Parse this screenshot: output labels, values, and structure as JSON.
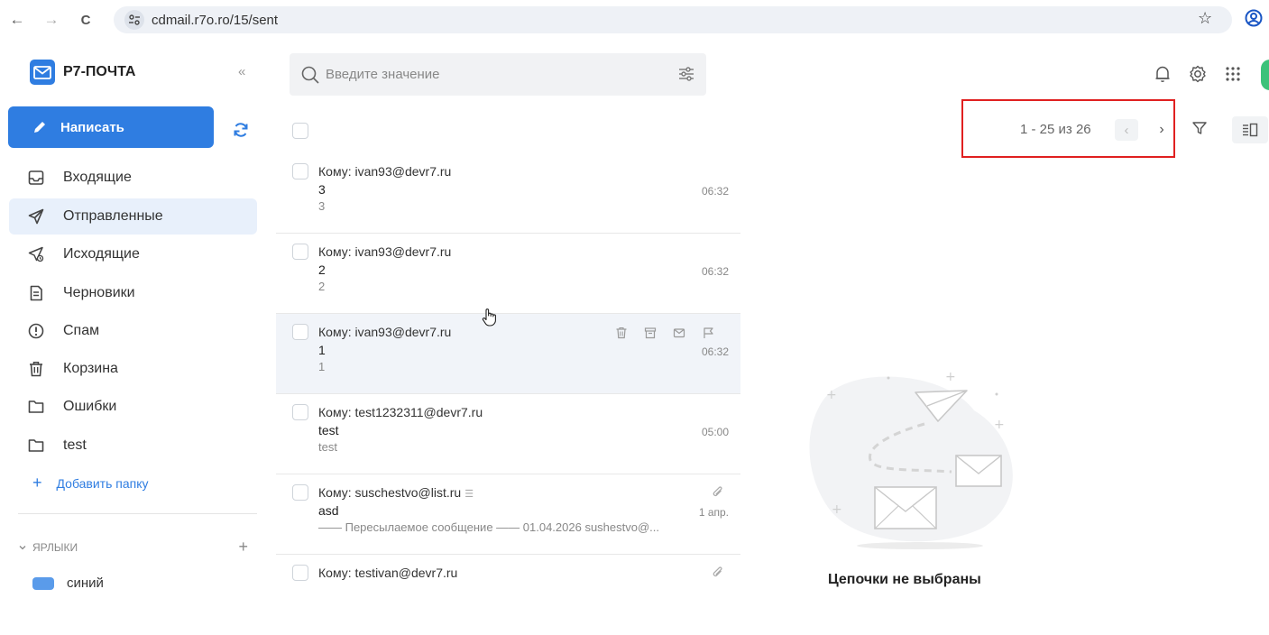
{
  "browser": {
    "url": "cdmail.r7o.ro/15/sent",
    "back_icon": "←",
    "forward_icon": "→",
    "reload_icon": "C",
    "star_icon": "☆"
  },
  "app": {
    "name": "Р7-ПОЧТА",
    "collapse_icon": "«",
    "brand_color": "#2f7de1"
  },
  "compose": {
    "label": "Написать"
  },
  "folders": [
    {
      "label": "Входящие",
      "icon": "inbox-icon"
    },
    {
      "label": "Отправленные",
      "icon": "send-icon",
      "active": true
    },
    {
      "label": "Исходящие",
      "icon": "outbox-icon"
    },
    {
      "label": "Черновики",
      "icon": "drafts-icon"
    },
    {
      "label": "Спам",
      "icon": "spam-icon"
    },
    {
      "label": "Корзина",
      "icon": "trash-icon"
    },
    {
      "label": "Ошибки",
      "icon": "folder-icon"
    },
    {
      "label": "test",
      "icon": "folder-icon"
    }
  ],
  "add_folder": {
    "plus": "+",
    "label": "Добавить папку"
  },
  "labels": {
    "heading": "ЯРЛЫКИ",
    "add": "+",
    "items": [
      {
        "label": "синий",
        "color": "#5a9bea"
      }
    ]
  },
  "search": {
    "placeholder": "Введите значение"
  },
  "pagination": {
    "text": "1 - 25 из 26",
    "prev": "‹",
    "next": "›"
  },
  "messages": [
    {
      "to": "Кому: ivan93@devr7.ru",
      "subject": "3",
      "preview": "3",
      "time": "06:32",
      "attachment": false,
      "hover": false
    },
    {
      "to": "Кому: ivan93@devr7.ru",
      "subject": "2",
      "preview": "2",
      "time": "06:32",
      "attachment": false,
      "hover": false
    },
    {
      "to": "Кому: ivan93@devr7.ru",
      "subject": "1",
      "preview": "1",
      "time": "06:32",
      "attachment": false,
      "hover": true
    },
    {
      "to": "Кому: test1232311@devr7.ru",
      "subject": "test",
      "preview": "test",
      "time": "05:00",
      "attachment": false,
      "hover": false
    },
    {
      "to": "Кому: suschestvo@list.ru",
      "subject": "asd",
      "preview": "—— Пересылаемое сообщение —— 01.04.2026 sushestvo@...",
      "time": "1 апр.",
      "attachment": true,
      "hover": false
    },
    {
      "to": "Кому: testivan@devr7.ru",
      "subject": "",
      "preview": "",
      "time": "",
      "attachment": true,
      "hover": false
    }
  ],
  "empty_state": {
    "text": "Цепочки не выбраны"
  },
  "highlight_color": "#e02020"
}
